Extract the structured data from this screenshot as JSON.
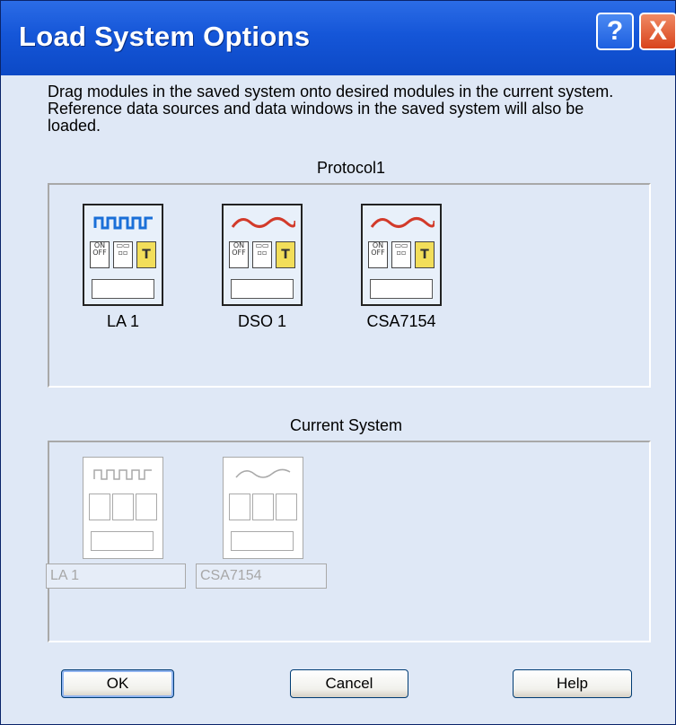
{
  "window": {
    "title": "Load System Options",
    "help_glyph": "?",
    "close_glyph": "X"
  },
  "description": "Drag modules in the saved system onto desired modules in the current system. Reference data sources and data windows in the saved system will also be loaded.",
  "saved_group": {
    "label": "Protocol1",
    "modules": [
      {
        "label": "LA 1",
        "icon": "logic-analyzer-icon",
        "wave_color": "#1a6fd8"
      },
      {
        "label": "DSO 1",
        "icon": "oscilloscope-icon",
        "wave_color": "#d23a2a"
      },
      {
        "label": "CSA7154",
        "icon": "oscilloscope-icon",
        "wave_color": "#d23a2a"
      }
    ],
    "switch_labels": {
      "on_off_top": "ON",
      "on_off_bottom": "OFF",
      "trigger": "T"
    }
  },
  "current_group": {
    "label": "Current System",
    "modules": [
      {
        "label": "LA 1",
        "icon": "logic-analyzer-icon"
      },
      {
        "label": "CSA7154",
        "icon": "oscilloscope-icon"
      }
    ]
  },
  "buttons": {
    "ok": "OK",
    "cancel": "Cancel",
    "help": "Help"
  }
}
